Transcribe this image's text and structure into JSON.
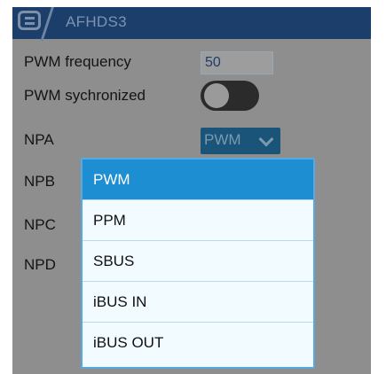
{
  "header": {
    "title": "AFHDS3",
    "menu_icon": "menu-icon"
  },
  "settings": {
    "pwm_frequency": {
      "label": "PWM frequency",
      "value": "50"
    },
    "pwm_synchronized": {
      "label": "PWM sychronized",
      "state": "off"
    },
    "npa": {
      "label": "NPA",
      "value": "PWM"
    },
    "npb": {
      "label": "NPB"
    },
    "npc": {
      "label": "NPC"
    },
    "npd": {
      "label": "NPD"
    }
  },
  "dropdown": {
    "options": [
      "PWM",
      "PPM",
      "SBUS",
      "iBUS IN",
      "iBUS OUT"
    ],
    "selected": "PWM"
  },
  "colors": {
    "header_bg": "#1b3f6a",
    "screen_bg": "#8e8e8e",
    "select_bg": "#1a5478",
    "dropdown_bg": "#f2fbff",
    "dropdown_border": "#5aa8e0",
    "selected_bg": "#1e8ed3"
  }
}
